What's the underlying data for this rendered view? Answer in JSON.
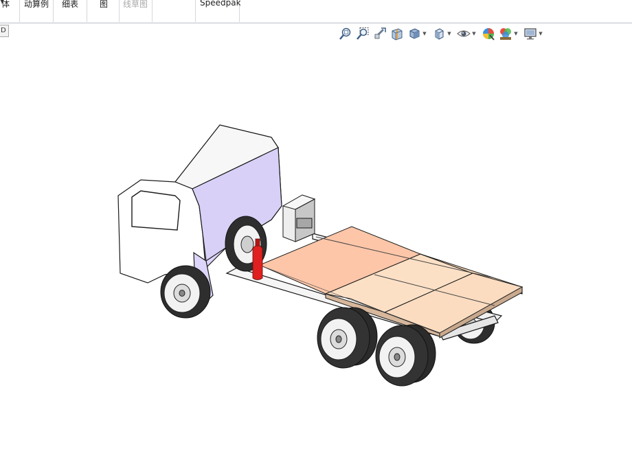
{
  "ribbon": {
    "tabs": [
      {
        "label": "体",
        "disabled": false
      },
      {
        "label": "动算例",
        "disabled": false
      },
      {
        "label": "细表",
        "disabled": false
      },
      {
        "label": "图",
        "disabled": false
      },
      {
        "label": "线草图",
        "disabled": true
      },
      {
        "label": "",
        "disabled": false
      },
      {
        "label": "Speedpak",
        "disabled": false
      }
    ]
  },
  "tree_tab": {
    "label": "D"
  },
  "heads_up_toolbar": {
    "buttons": [
      {
        "icon": "zoom-to-fit-icon"
      },
      {
        "icon": "zoom-to-area-icon"
      },
      {
        "icon": "previous-view-icon"
      },
      {
        "icon": "section-view-icon"
      },
      {
        "icon": "view-orientation-icon",
        "dropdown": true
      },
      {
        "icon": "display-style-icon",
        "dropdown": true
      },
      {
        "icon": "hide-show-items-icon",
        "dropdown": true
      },
      {
        "icon": "edit-appearance-icon"
      },
      {
        "icon": "apply-scene-icon",
        "dropdown": true
      },
      {
        "icon": "view-settings-icon",
        "dropdown": true
      }
    ]
  },
  "model": {
    "name": "truck-chassis-assembly",
    "colors": {
      "cab_side": "#ddd5fa",
      "bed_front_left": "#fdc6a8",
      "bed_front_right": "#fce0c6",
      "bed_rear": "#fbd8b7",
      "extinguisher": "#e02020",
      "tire": "#303030",
      "outline": "#1a1a1a"
    }
  }
}
